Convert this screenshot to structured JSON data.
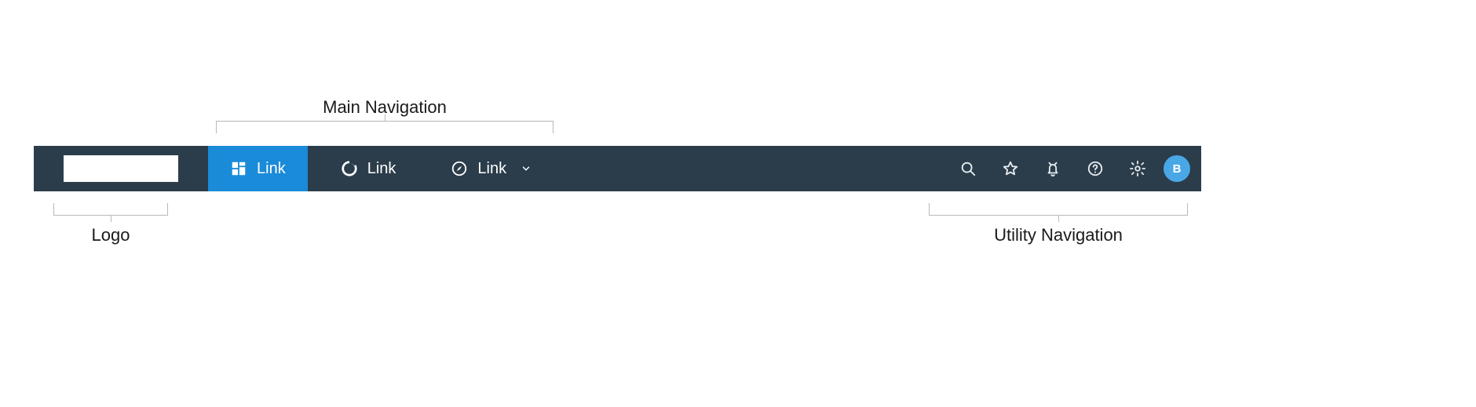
{
  "annotations": {
    "main_nav": "Main Navigation",
    "logo": "Logo",
    "utility_nav": "Utility Navigation"
  },
  "main_nav": {
    "items": [
      {
        "label": "Link"
      },
      {
        "label": "Link"
      },
      {
        "label": "Link"
      }
    ]
  },
  "utility": {
    "search": "search",
    "star": "favorites",
    "bell": "notifications",
    "help": "help",
    "settings": "settings"
  },
  "avatar": {
    "initial": "B"
  }
}
